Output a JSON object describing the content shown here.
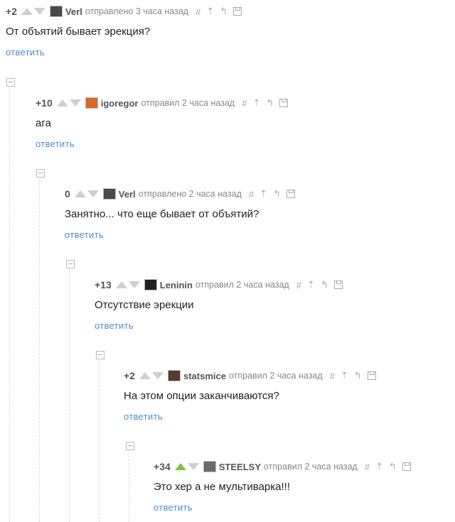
{
  "comments": [
    {
      "rating": "+2",
      "author": "Verl",
      "meta": "отправлено 3 часа назад",
      "text": "От объятий бывает эрекция?",
      "reply": "ответить",
      "avatar": "avatar-verl"
    },
    {
      "rating": "+10",
      "author": "igoregor",
      "meta": "отправил 2 часа назад",
      "text": "ага",
      "reply": "ответить",
      "avatar": "avatar-igoregor"
    },
    {
      "rating": "0",
      "author": "Verl",
      "meta": "отправлено 2 часа назад",
      "text": "Занятно... что еще бывает от объятий?",
      "reply": "ответить",
      "avatar": "avatar-verl"
    },
    {
      "rating": "+13",
      "author": "Leninin",
      "meta": "отправил 2 часа назад",
      "text": "Отсутствие эрекции",
      "reply": "ответить",
      "avatar": "avatar-leninin"
    },
    {
      "rating": "+2",
      "author": "statsmice",
      "meta": "отправил 2 часа назад",
      "text": "На этом опции заканчиваются?",
      "reply": "ответить",
      "avatar": "avatar-statsmice"
    },
    {
      "rating": "+34",
      "author": "STEELSY",
      "meta": "отправил 2 часа назад",
      "text": "Это хер а не мультиварка!!!",
      "reply": "ответить",
      "avatar": "avatar-steelsy",
      "upvoted": true
    }
  ],
  "tools": {
    "hash": "#",
    "up": "⇡",
    "parent": "↰"
  },
  "colors": {
    "link": "#4a8fd0",
    "upvote_active": "#7ac142",
    "muted": "#888"
  }
}
